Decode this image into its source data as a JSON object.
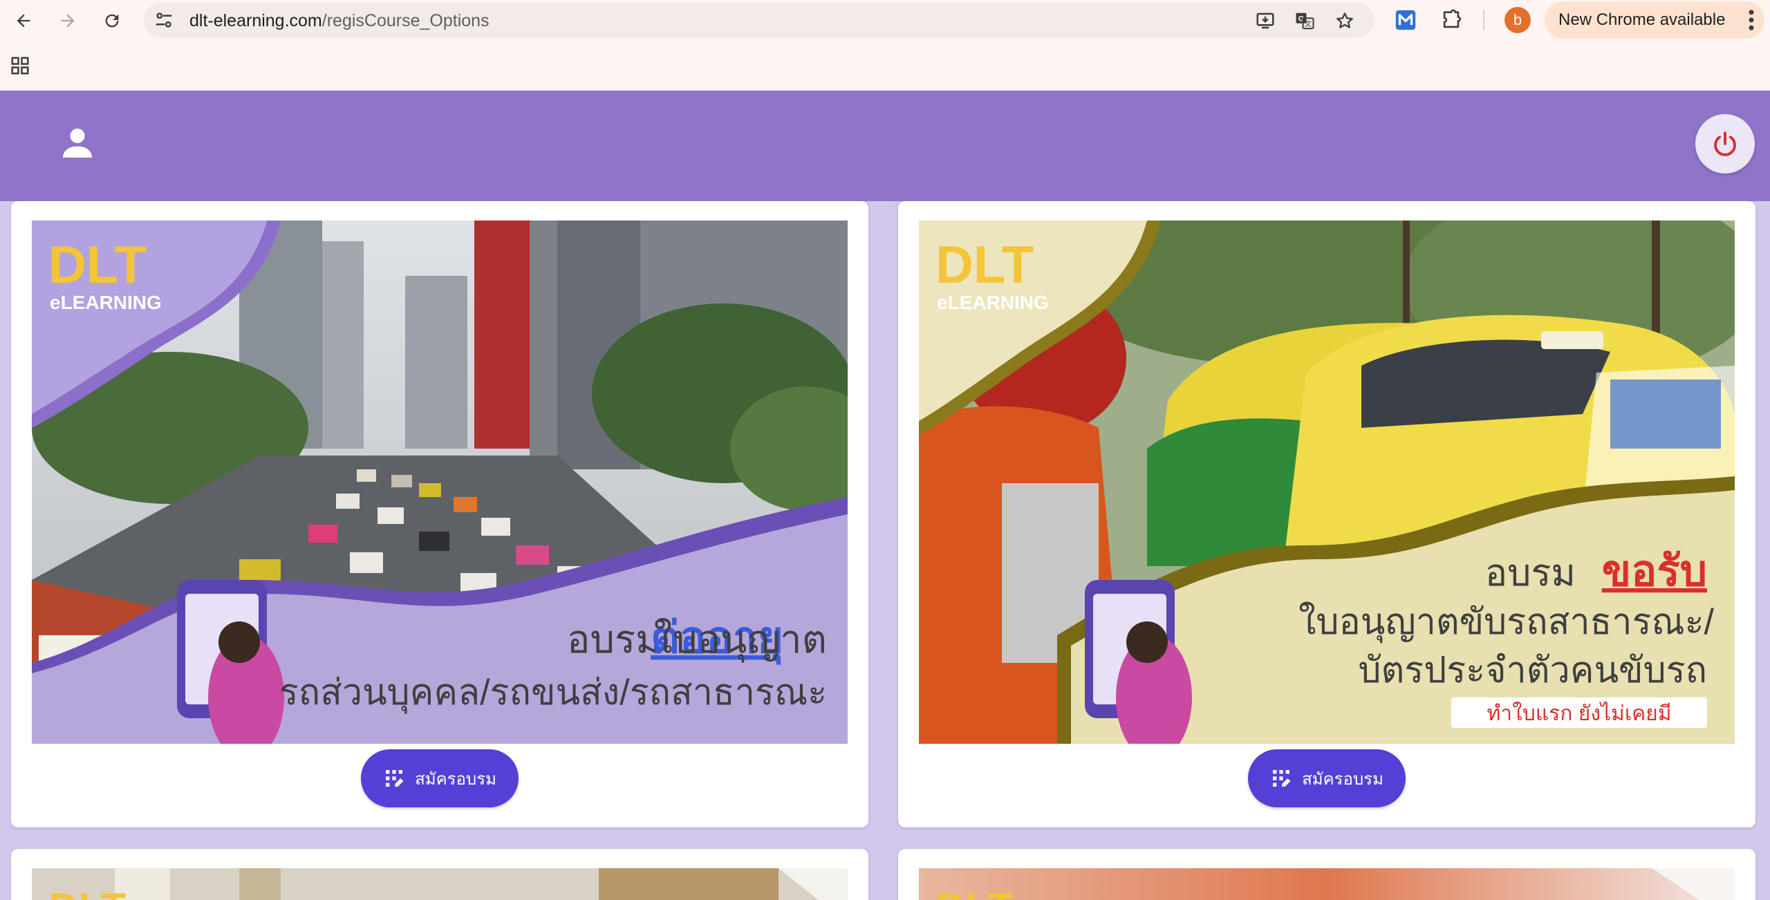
{
  "browser": {
    "url_domain": "dlt-elearning.com",
    "url_path": "/regisCourse_Options",
    "profile_initial": "b",
    "update_label": "New Chrome available",
    "icons": [
      "back-icon",
      "forward-icon",
      "reload-icon",
      "site-settings-icon",
      "install-app-icon",
      "translate-icon",
      "bookmark-star-icon",
      "extension-m-icon",
      "extensions-puzzle-icon",
      "more-menu-icon",
      "apps-grid-icon"
    ]
  },
  "header": {
    "user_icon": "person-icon",
    "logout_icon": "power-icon",
    "brand_color": "#9074c9"
  },
  "courses": [
    {
      "logo_main": "DLT",
      "logo_sub": "eLEARNING",
      "line1_prefix": "อบรม",
      "line1_highlight": "ต่ออายุ",
      "line1_suffix": "ใบอนุญาต",
      "line2": "รถส่วนบุคคล/รถขนส่ง/รถสาธารณะ",
      "button_label": "สมัครอบรม",
      "highlight_color": "#3b5bdb"
    },
    {
      "logo_main": "DLT",
      "logo_sub": "eLEARNING",
      "line1_prefix": "อบรม",
      "line1_highlight": "ขอรับ",
      "line2": "ใบอนุญาตขับรถสาธารณะ/",
      "line3": "บัตรประจำตัวคนขับรถ",
      "tag": "ทำใบแรก ยังไม่เคยมี",
      "button_label": "สมัครอบรม",
      "highlight_color": "#d9302c"
    },
    {
      "logo_main": "DLT"
    },
    {
      "logo_main": "DLT"
    }
  ],
  "colors": {
    "page_bg": "#d4c7ec",
    "button": "#5440d6",
    "banner1_panel": "#b5a7da",
    "banner2_panel": "#e8e0b0"
  }
}
